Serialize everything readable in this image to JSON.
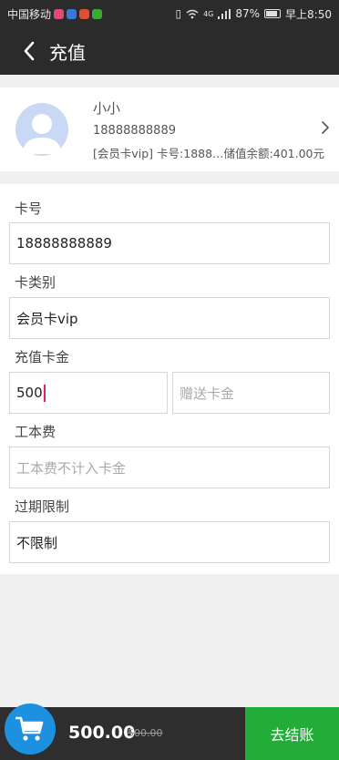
{
  "status_bar": {
    "carrier": "中国移动",
    "battery": "87%",
    "time": "早上8:50",
    "network": "4G"
  },
  "nav": {
    "title": "充值",
    "back_icon": "chevron-left-icon"
  },
  "member": {
    "name": "小小",
    "phone": "18888888889",
    "detail": "[会员卡vip] 卡号:1888…储值余额:401.00元"
  },
  "form": {
    "card_no": {
      "label": "卡号",
      "value": "18888888889"
    },
    "card_type": {
      "label": "卡类别",
      "value": "会员卡vip"
    },
    "recharge": {
      "label": "充值卡金",
      "value": "500",
      "bonus_placeholder": "赠送卡金"
    },
    "labor_fee": {
      "label": "工本费",
      "placeholder": "工本费不计入卡金"
    },
    "expiry": {
      "label": "过期限制",
      "value": "不限制"
    }
  },
  "footer": {
    "total": "500.00",
    "original": "500.00",
    "checkout": "去结账",
    "cart_icon": "cart-icon"
  },
  "colors": {
    "bar": "#2b2b2b",
    "checkout": "#22ac38",
    "cart": "#1e90e0",
    "caret": "#e0245e"
  }
}
